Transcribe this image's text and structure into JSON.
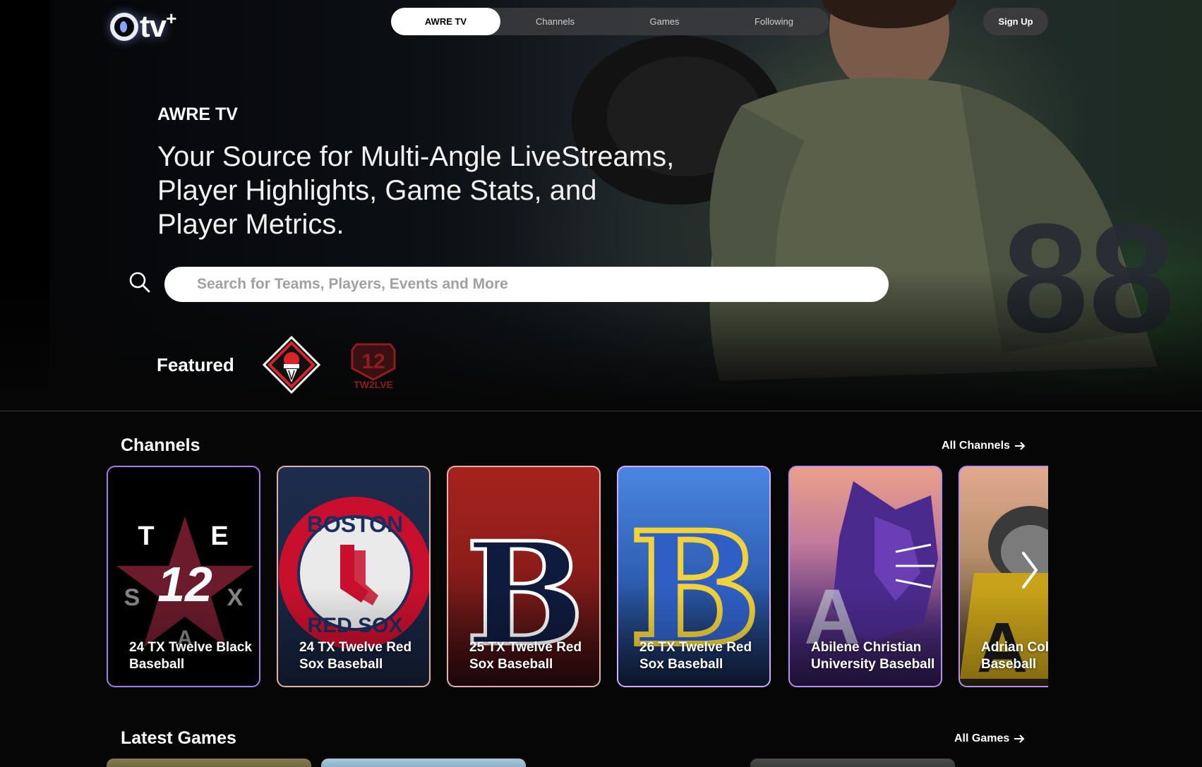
{
  "nav": {
    "logo_text": "tv",
    "logo_plus": "+",
    "tabs": [
      {
        "label": "AWRE TV",
        "active": true
      },
      {
        "label": "Channels",
        "active": false
      },
      {
        "label": "Games",
        "active": false
      },
      {
        "label": "Following",
        "active": false
      }
    ],
    "signup_label": "Sign Up"
  },
  "hero": {
    "brand": "AWRE TV",
    "tagline": "Your Source for Multi-Angle LiveStreams, Player Highlights, Game Stats, and Player Metrics.",
    "search_placeholder": "Search for Teams, Players, Events and More",
    "featured_label": "Featured",
    "featured_logo_2_text": "TW2LVE"
  },
  "channels": {
    "title": "Channels",
    "link_label": "All Channels",
    "items": [
      {
        "title": "24 TX Twelve Black Baseball"
      },
      {
        "title": "24 TX Twelve Red Sox Baseball"
      },
      {
        "title": "25 TX Twelve Red Sox Baseball"
      },
      {
        "title": "26 TX Twelve Red Sox Baseball"
      },
      {
        "title": "Abilene Christian University Baseball"
      },
      {
        "title": "Adrian College Baseball"
      }
    ]
  },
  "latest_games": {
    "title": "Latest Games",
    "link_label": "All Games"
  },
  "colors": {
    "card_border": "#a47cf0",
    "nav_active_bg": "#ffffff",
    "page_bg": "#060606"
  }
}
